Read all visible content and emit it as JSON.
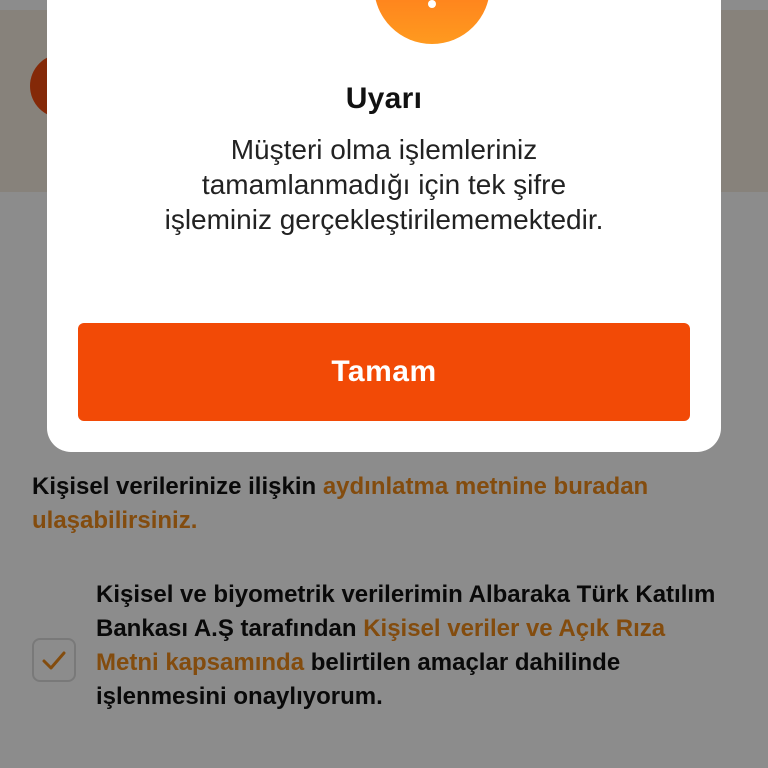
{
  "colors": {
    "accent": "#f24a06",
    "link": "#ef8a1a",
    "warning_gradient_top": "#ff6a1a",
    "warning_gradient_bottom": "#ff9a1f"
  },
  "dialog": {
    "icon": "warning-exclamation-icon",
    "title": "Uyarı",
    "message_lines": [
      "Müşteri olma işlemleriniz",
      "tamamlanmadığı için tek şifre",
      "işleminiz gerçekleştirilememektedir."
    ],
    "ok_label": "Tamam"
  },
  "kvkk": {
    "text": "Kişisel verilerinize ilişkin ",
    "link_text": "aydınlatma metnine buradan ulaşabilirsiniz."
  },
  "consent": {
    "checked": true,
    "text_before": "Kişisel ve biyometrik verilerimin Albaraka Türk Katılım Bankası A.Ş tarafından ",
    "link_text": "Kişisel veriler ve Açık Rıza Metni kapsamında",
    "text_after": " belirtilen amaçlar dahilinde işlenmesini onaylıyorum."
  }
}
